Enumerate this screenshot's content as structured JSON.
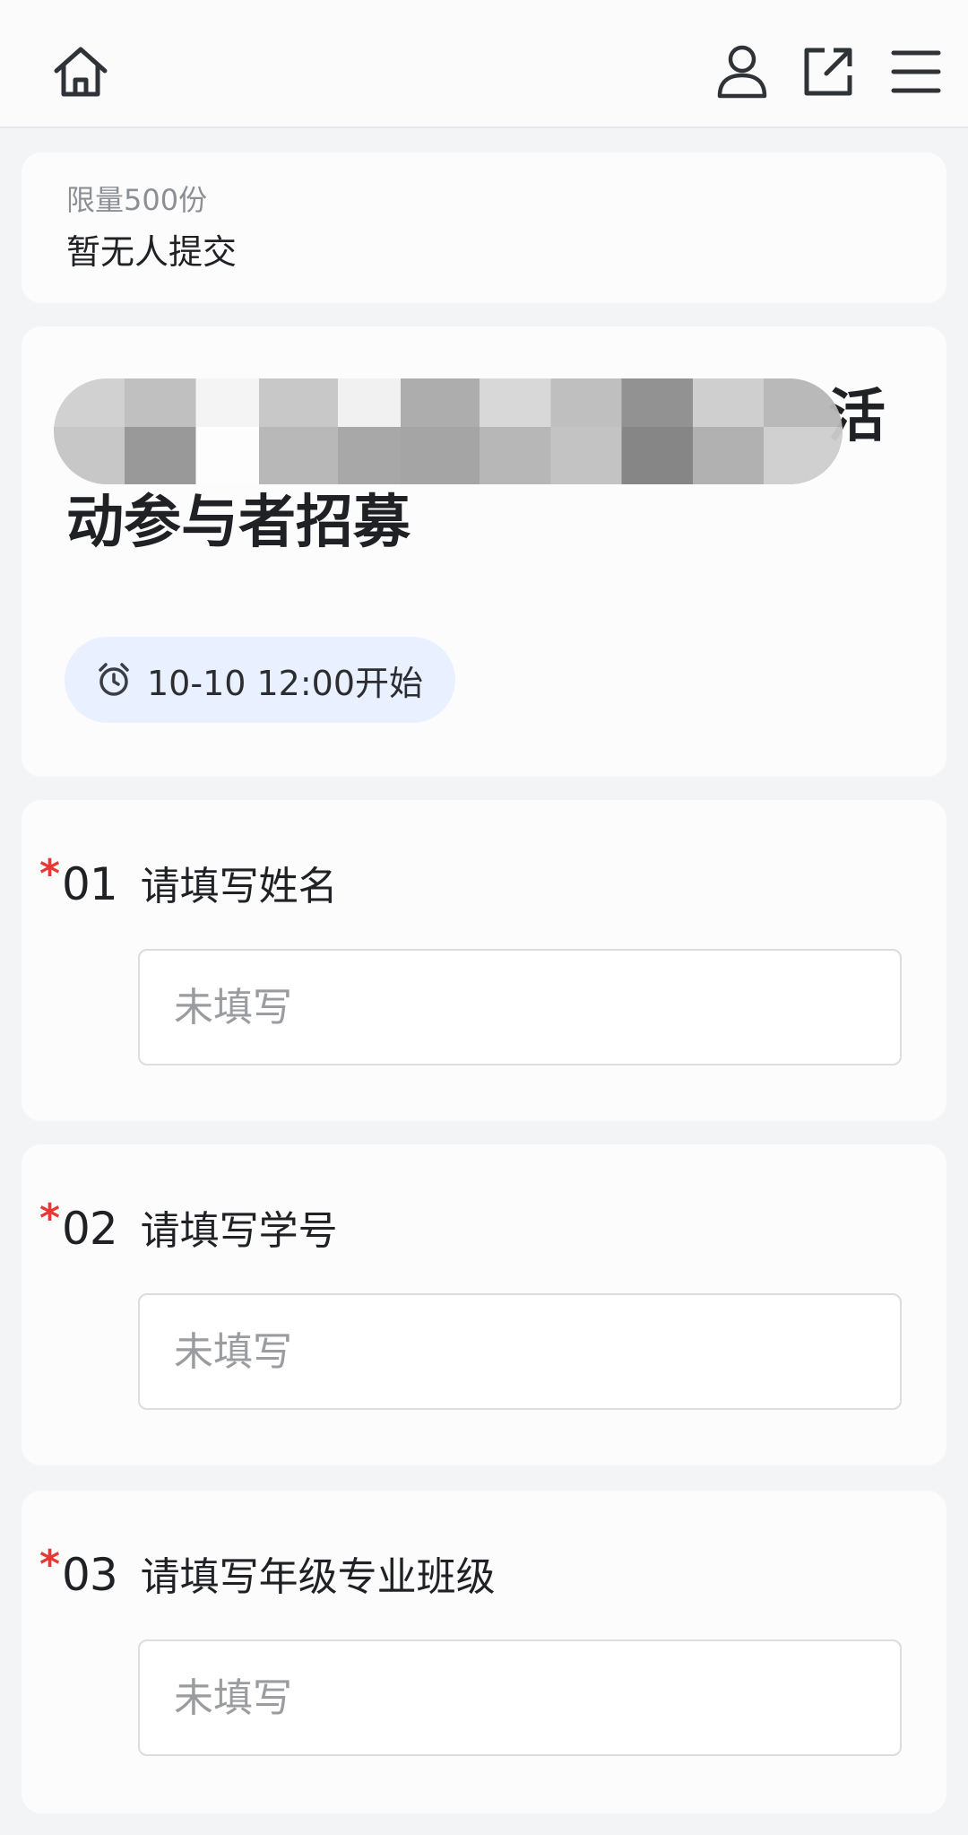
{
  "header": {
    "icons": [
      "home-icon",
      "user-icon",
      "share-icon",
      "menu-icon"
    ]
  },
  "summary": {
    "limit": "限量500份",
    "submissions": "暂无人提交"
  },
  "event": {
    "title": "活动参与者招募",
    "start_time": "10-10 12:00开始"
  },
  "questions": [
    {
      "required_mark": "*",
      "number": "01",
      "label": "请填写姓名",
      "value": "",
      "placeholder": "未填写"
    },
    {
      "required_mark": "*",
      "number": "02",
      "label": "请填写学号",
      "value": "",
      "placeholder": "未填写"
    },
    {
      "required_mark": "*",
      "number": "03",
      "label": "请填写年级专业班级",
      "value": "",
      "placeholder": "未填写"
    }
  ],
  "colors": {
    "required": "#e53935",
    "pill_bg": "#e9f0ff",
    "page_bg": "#f3f4f6"
  }
}
